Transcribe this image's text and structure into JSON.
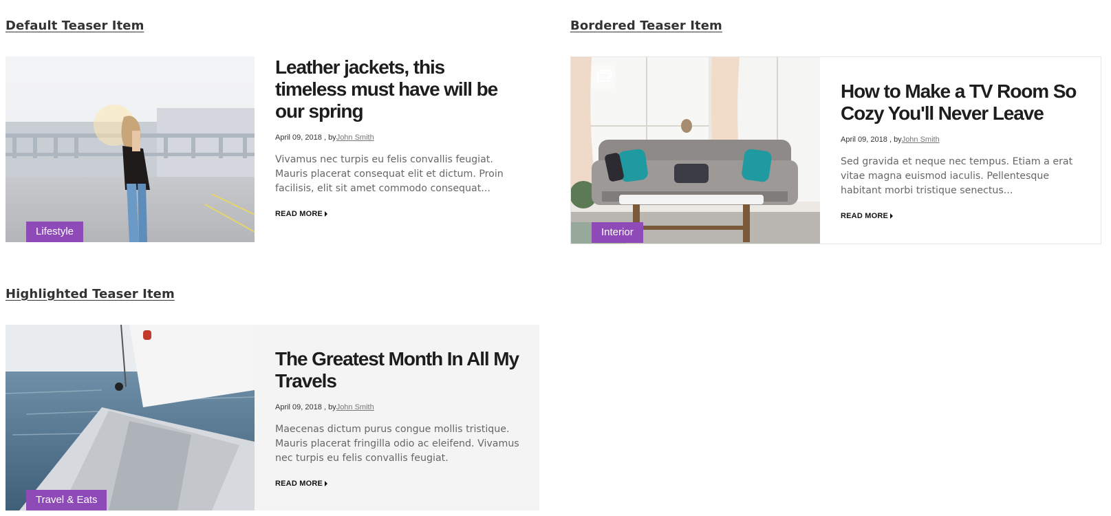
{
  "sections": {
    "default": {
      "heading": "Default Teaser Item",
      "category": "Lifestyle",
      "title": "Leather jackets, this timeless must have will be our spring",
      "date": "April 09, 2018",
      "by": ", by",
      "author": "John Smith",
      "excerpt": "Vivamus nec turpis eu felis convallis feugiat. Mauris placerat consequat elit et dictum. Proin facilisis, elit sit amet commodo consequat...",
      "read_more": "READ MORE"
    },
    "bordered": {
      "heading": "Bordered Teaser Item",
      "category": "Interior",
      "title": "How to Make a TV Room So Cozy You'll Never Leave",
      "date": "April 09, 2018",
      "by": ", by",
      "author": "John Smith",
      "excerpt": "Sed gravida et neque nec tempus. Etiam a erat vitae magna euismod iaculis. Pellentesque habitant morbi tristique senectus...",
      "read_more": "READ MORE"
    },
    "highlighted": {
      "heading": "Highlighted Teaser Item",
      "category": "Travel & Eats",
      "title": "The Greatest Month In All My Travels",
      "date": "April 09, 2018",
      "by": ", by",
      "author": "John Smith",
      "excerpt": "Maecenas dictum purus congue mollis tristique. Mauris placerat fringilla odio ac eleifend. Vivamus nec turpis eu felis convallis feugiat.",
      "read_more": "READ MORE"
    }
  },
  "colors": {
    "category_badge": "#8e4bb8",
    "highlight_bg": "#f4f4f4",
    "border": "#e6e6e6"
  }
}
